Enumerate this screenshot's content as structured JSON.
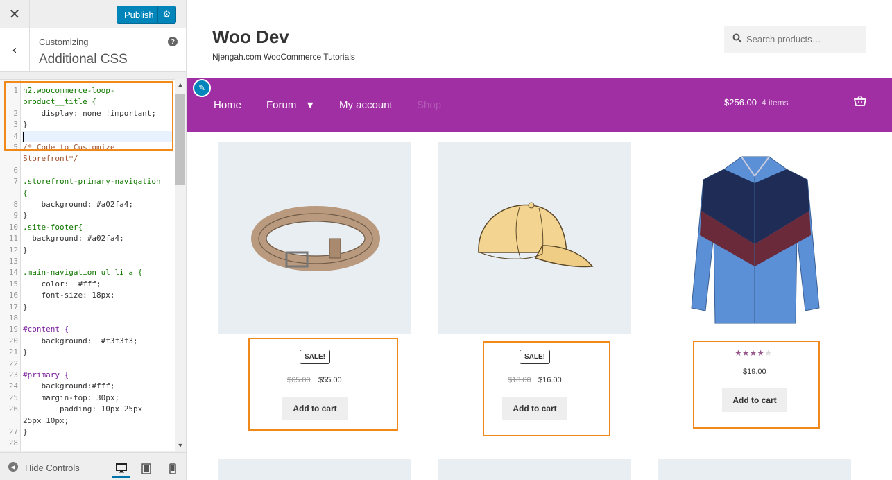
{
  "customizer": {
    "close_label": "✕",
    "publish_label": "Publish",
    "section_small": "Customizing",
    "section_title": "Additional CSS",
    "help_label": "?",
    "footer_hide_label": "Hide Controls",
    "css_lines": [
      {
        "n": "1",
        "code": "h2.woocommerce-loop-"
      },
      {
        "n": "",
        "code": "product__title {"
      },
      {
        "n": "2",
        "code": "    display: none !important;"
      },
      {
        "n": "3",
        "code": "}"
      },
      {
        "n": "4",
        "code": ""
      },
      {
        "n": "5",
        "code": "/* Code to Customize"
      },
      {
        "n": "",
        "code": "Storefront*/"
      },
      {
        "n": "6",
        "code": ""
      },
      {
        "n": "7",
        "code": ".storefront-primary-navigation"
      },
      {
        "n": "",
        "code": "{"
      },
      {
        "n": "8",
        "code": "    background: #a02fa4;"
      },
      {
        "n": "9",
        "code": "}"
      },
      {
        "n": "10",
        "code": ".site-footer{"
      },
      {
        "n": "11",
        "code": "  background: #a02fa4;"
      },
      {
        "n": "12",
        "code": "}"
      },
      {
        "n": "13",
        "code": ""
      },
      {
        "n": "14",
        "code": ".main-navigation ul li a {"
      },
      {
        "n": "15",
        "code": "    color:  #fff;"
      },
      {
        "n": "16",
        "code": "    font-size: 18px;"
      },
      {
        "n": "17",
        "code": "}"
      },
      {
        "n": "18",
        "code": ""
      },
      {
        "n": "19",
        "code": "#content {"
      },
      {
        "n": "20",
        "code": "    background:  #f3f3f3;"
      },
      {
        "n": "21",
        "code": "}"
      },
      {
        "n": "22",
        "code": ""
      },
      {
        "n": "23",
        "code": "#primary {"
      },
      {
        "n": "24",
        "code": "    background:#fff;"
      },
      {
        "n": "25",
        "code": "    margin-top: 30px;"
      },
      {
        "n": "26",
        "code": "        padding: 10px 25px"
      },
      {
        "n": "",
        "code": "25px 10px;"
      },
      {
        "n": "27",
        "code": "}"
      },
      {
        "n": "28",
        "code": ""
      }
    ]
  },
  "site": {
    "title": "Woo Dev",
    "tagline": "Njengah.com WooCommerce Tutorials",
    "search_placeholder": "Search products…"
  },
  "nav": {
    "items": [
      "Home",
      "Forum",
      "My account",
      "Shop"
    ],
    "cart_total": "$256.00",
    "cart_count": "4 items"
  },
  "products": [
    {
      "image": "belt",
      "badge": "SALE!",
      "old_price": "$65.00",
      "price": "$55.00",
      "button": "Add to cart"
    },
    {
      "image": "cap",
      "badge": "SALE!",
      "old_price": "$18.00",
      "price": "$16.00",
      "button": "Add to cart"
    },
    {
      "image": "shirt",
      "rating_stars": 4,
      "rating_max": 5,
      "price": "$19.00",
      "button": "Add to cart"
    }
  ],
  "colors": {
    "nav_bg": "#a02fa4",
    "publish_bg": "#0085ba",
    "highlight": "#f0891c",
    "star": "#96588a"
  }
}
